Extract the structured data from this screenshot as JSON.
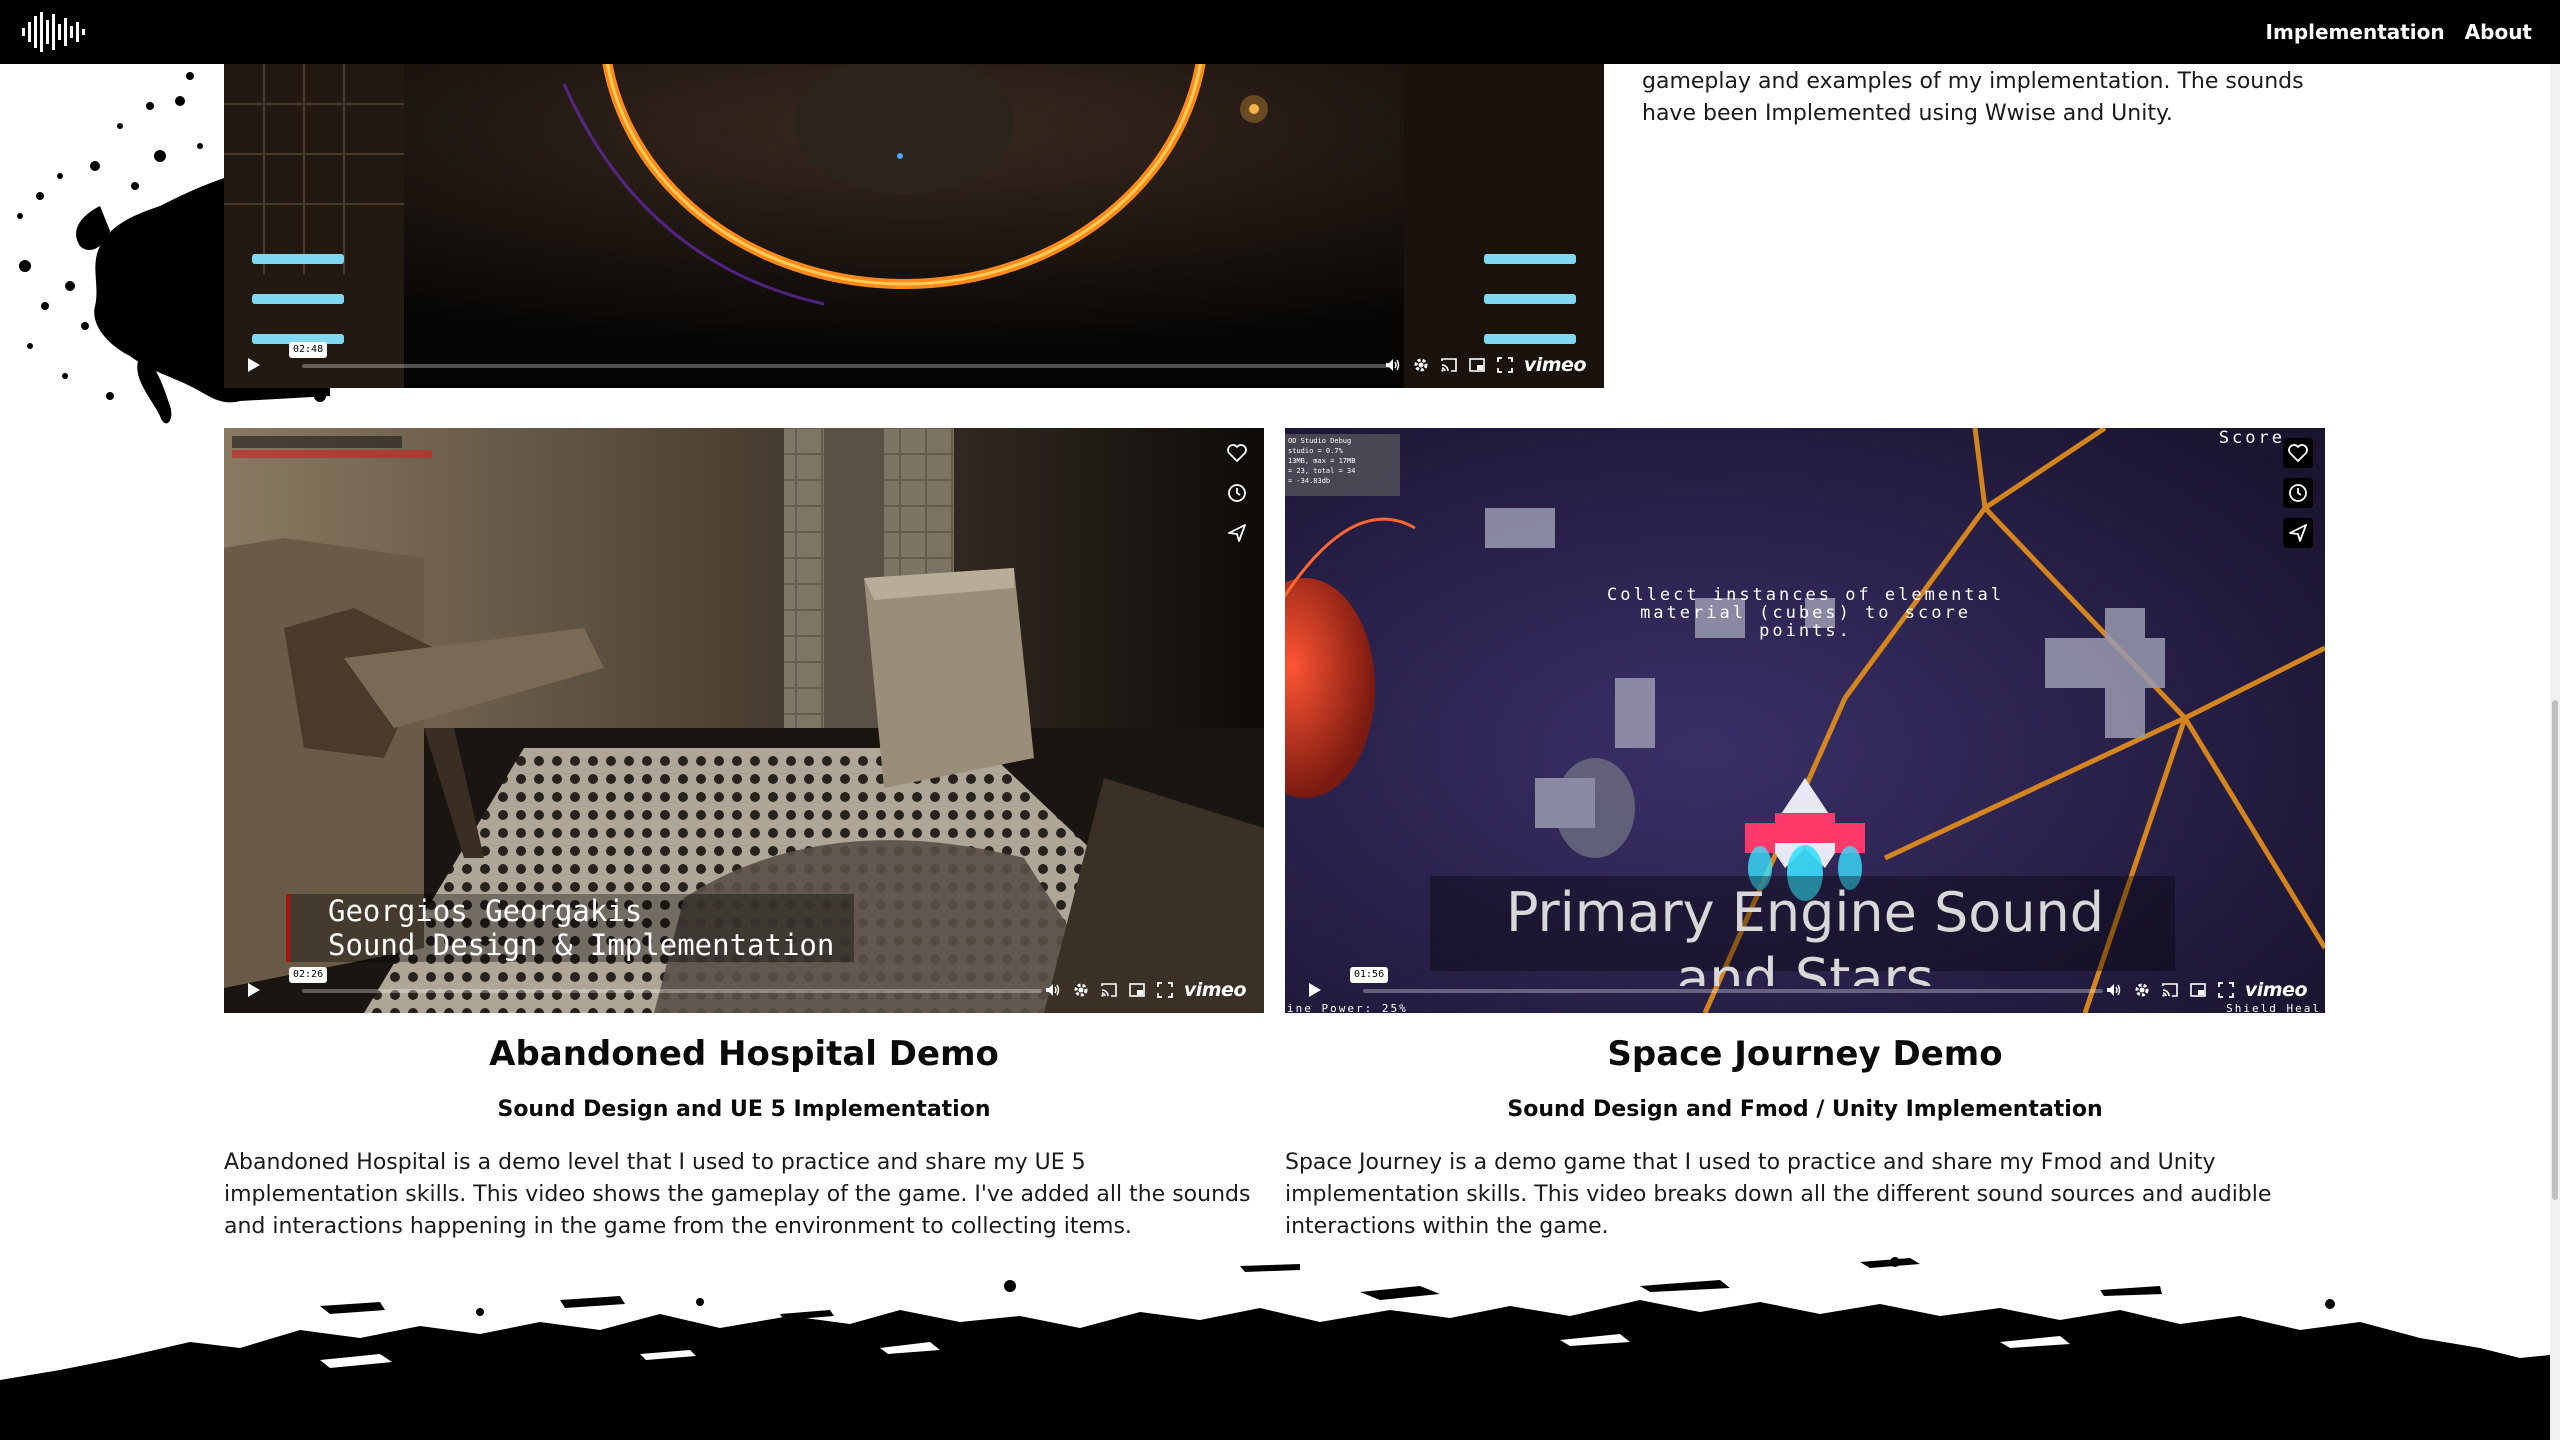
{
  "nav": {
    "logo_icon": "soundwave-logo-icon",
    "links": [
      "Implementation",
      "About"
    ]
  },
  "top_video": {
    "time": "02:48",
    "progress_fraction": 0.0,
    "brand": "vimeo",
    "description": "gameplay and examples of my implementation. The sounds have been Implemented using Wwise and Unity."
  },
  "cards": [
    {
      "title": "Abandoned Hospital Demo",
      "subtitle": "Sound Design and UE 5 Implementation",
      "description": "Abandoned Hospital is a demo level that I used to practice and share my UE 5 implementation skills. This video shows the gameplay of the game. I've added all the sounds and interactions happening in the game from the environment to collecting items.",
      "video": {
        "time": "02:26",
        "progress_fraction": 0.0,
        "brand": "vimeo",
        "overlay_name": "Georgios Georgakis",
        "overlay_role": "Sound Design & Implementation"
      }
    },
    {
      "title": "Space Journey Demo",
      "subtitle": "Sound Design and Fmod / Unity Implementation",
      "description": "Space Journey is a demo game that I used to practice and share my Fmod and Unity implementation skills. This video breaks down all the different sound sources and audible interactions within the game.",
      "video": {
        "time": "01:56",
        "progress_fraction": 0.0,
        "brand": "vimeo",
        "hud_top_right": "Score",
        "hud_debug": [
          "OD Studio Debug",
          "studio = 0.7%",
          "13MB, max = 17MB",
          "= 23, total = 34",
          "= -34.83db"
        ],
        "caption": "Collect instances of elemental material (cubes) to score points.",
        "subtitle_line1": "Primary Engine Sound",
        "subtitle_line2": "and Stars",
        "hud_bottom_left": "ine Power: 25%",
        "hud_bottom_right": "Shield Heal"
      }
    }
  ],
  "colors": {
    "nav_bg": "#000000",
    "text": "#1a1a1a",
    "ring": "#ff8a1c",
    "space_bg": "#2a1f4a"
  }
}
